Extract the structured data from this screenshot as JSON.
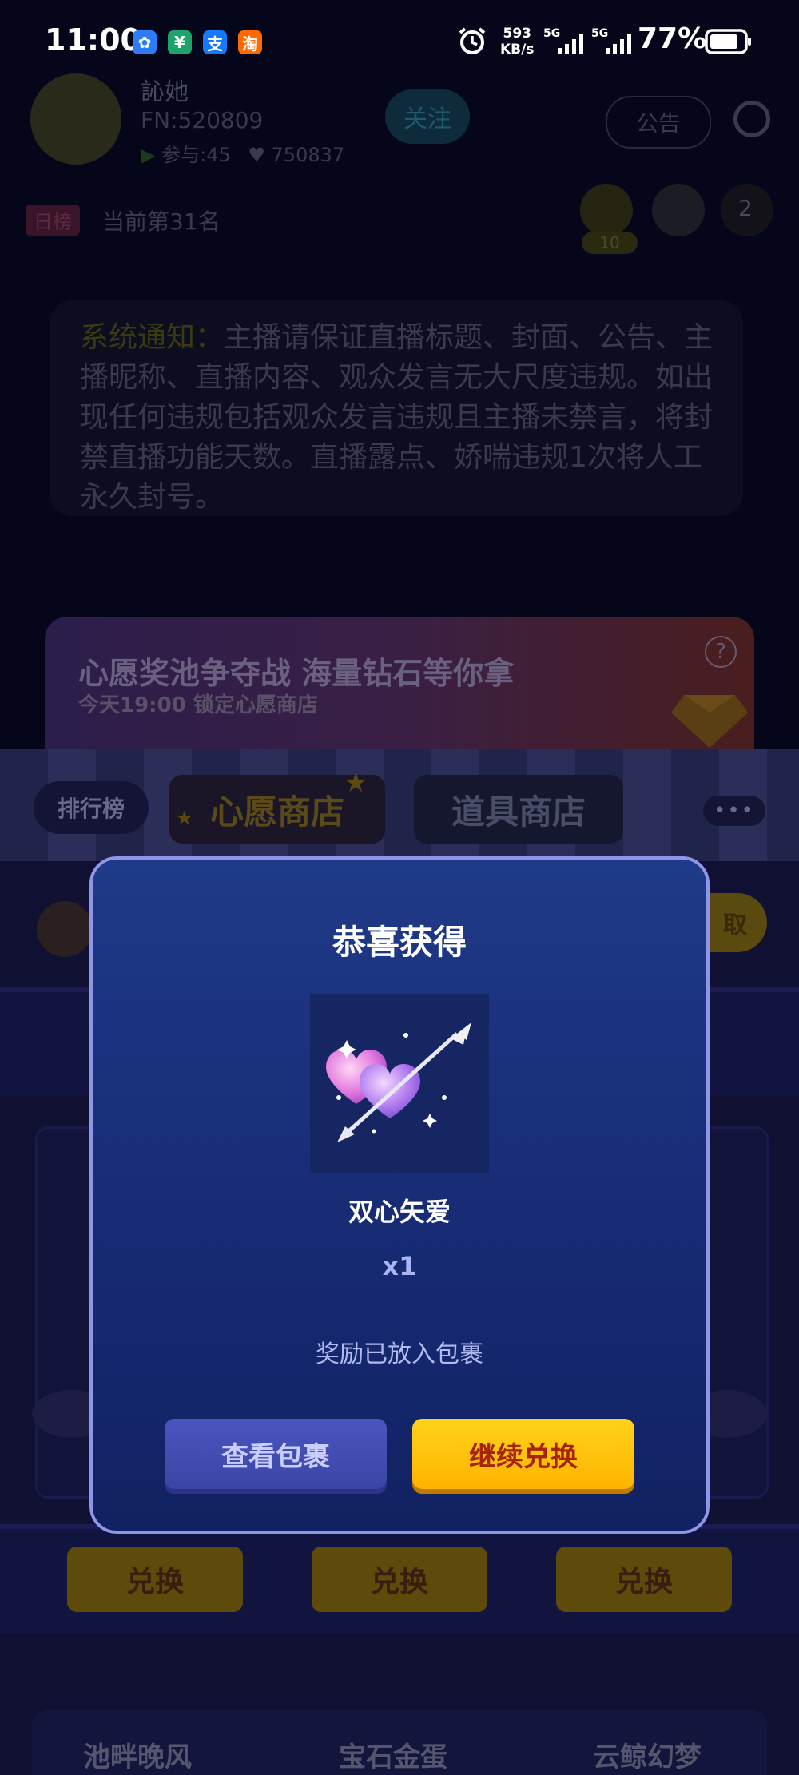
{
  "status_bar": {
    "time": "11:00",
    "app_icons": [
      {
        "name": "baidu-icon",
        "glyph": "✿",
        "color": "#2e7cf6"
      },
      {
        "name": "wallet-icon",
        "glyph": "¥",
        "color": "#1da36b"
      },
      {
        "name": "alipay-icon",
        "glyph": "支",
        "color": "#1677ff"
      },
      {
        "name": "taobao-icon",
        "glyph": "淘",
        "color": "#ff6a00"
      }
    ],
    "net_speed_value": "593",
    "net_speed_unit": "KB/s",
    "signal_label_1": "5G",
    "signal_label_2": "5G",
    "battery_percent": "77%"
  },
  "host": {
    "name": "訫她",
    "id": "FN:520809",
    "participants": "参与:45",
    "likes": "750837",
    "follow_label": "关注",
    "notice_label": "公告"
  },
  "ranking": {
    "badge": "日榜",
    "position_text": "当前第31名",
    "viewer_level": "10",
    "viewer_count": "2"
  },
  "system_notice": {
    "lead": "系统通知：",
    "body": "主播请保证直播标题、封面、公告、主播昵称、直播内容、观众发言无大尺度违规。如出现任何违规包括观众发言违规且主播未禁言，将封禁直播功能天数。直播露点、娇喘违规1次将人工永久封号。"
  },
  "shop": {
    "banner_title": "心愿奖池争夺战 海量钻石等你拿",
    "banner_subtitle": "今天19:00 锁定心愿商店",
    "help_label": "?",
    "tab_ranking": "排行榜",
    "tab_wish_shop": "心愿商店",
    "tab_props_shop": "道具商店",
    "more_label": "•••",
    "get_partial": "取",
    "redeem_buttons": [
      "兑换",
      "兑换",
      "兑换"
    ],
    "bottom_items": [
      "池畔晚风",
      "宝石金蛋",
      "云鲸幻梦"
    ]
  },
  "dialog": {
    "title": "恭喜获得",
    "prize_name": "双心矢爱",
    "prize_qty": "x1",
    "note": "奖励已放入包裹",
    "view_bag_label": "查看包裹",
    "continue_label": "继续兑换"
  },
  "colors": {
    "dialog_border": "#8f96e8",
    "dialog_bg": "#1f3a88",
    "primary_button": "#ffc107",
    "primary_button_text": "#a8230f",
    "secondary_button": "#4a56bf"
  }
}
